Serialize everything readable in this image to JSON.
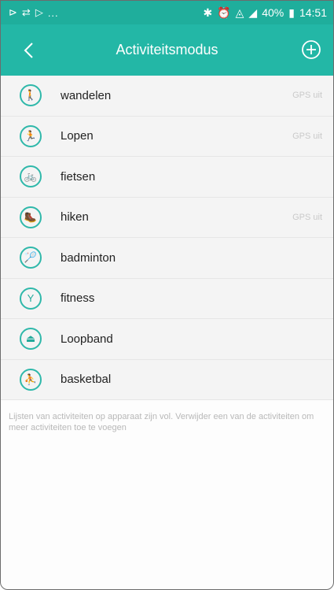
{
  "statusbar": {
    "left_icons": [
      "cast-icon",
      "sync-icon",
      "play-icon"
    ],
    "left_more": "...",
    "battery": "40%",
    "time": "14:51"
  },
  "appbar": {
    "title": "Activiteitsmodus"
  },
  "activities": [
    {
      "label": "wandelen",
      "icon": "walking-icon",
      "glyph": "🚶",
      "gps": "GPS uit"
    },
    {
      "label": "Lopen",
      "icon": "running-icon",
      "glyph": "🏃",
      "gps": "GPS uit"
    },
    {
      "label": "fietsen",
      "icon": "cycling-icon",
      "glyph": "🚲",
      "gps": ""
    },
    {
      "label": "hiken",
      "icon": "hiking-icon",
      "glyph": "🥾",
      "gps": "GPS uit"
    },
    {
      "label": "badminton",
      "icon": "badminton-icon",
      "glyph": "🏸",
      "gps": ""
    },
    {
      "label": "fitness",
      "icon": "fitness-icon",
      "glyph": "Y",
      "gps": ""
    },
    {
      "label": "Loopband",
      "icon": "treadmill-icon",
      "glyph": "⏏",
      "gps": ""
    },
    {
      "label": "basketbal",
      "icon": "basketball-icon",
      "glyph": "⛹",
      "gps": ""
    }
  ],
  "note": "Lijsten van activiteiten op apparaat zijn vol. Verwijder een van de activiteiten om meer activiteiten toe te voegen",
  "colors": {
    "accent": "#23b7a6",
    "status": "#1fae9c"
  }
}
